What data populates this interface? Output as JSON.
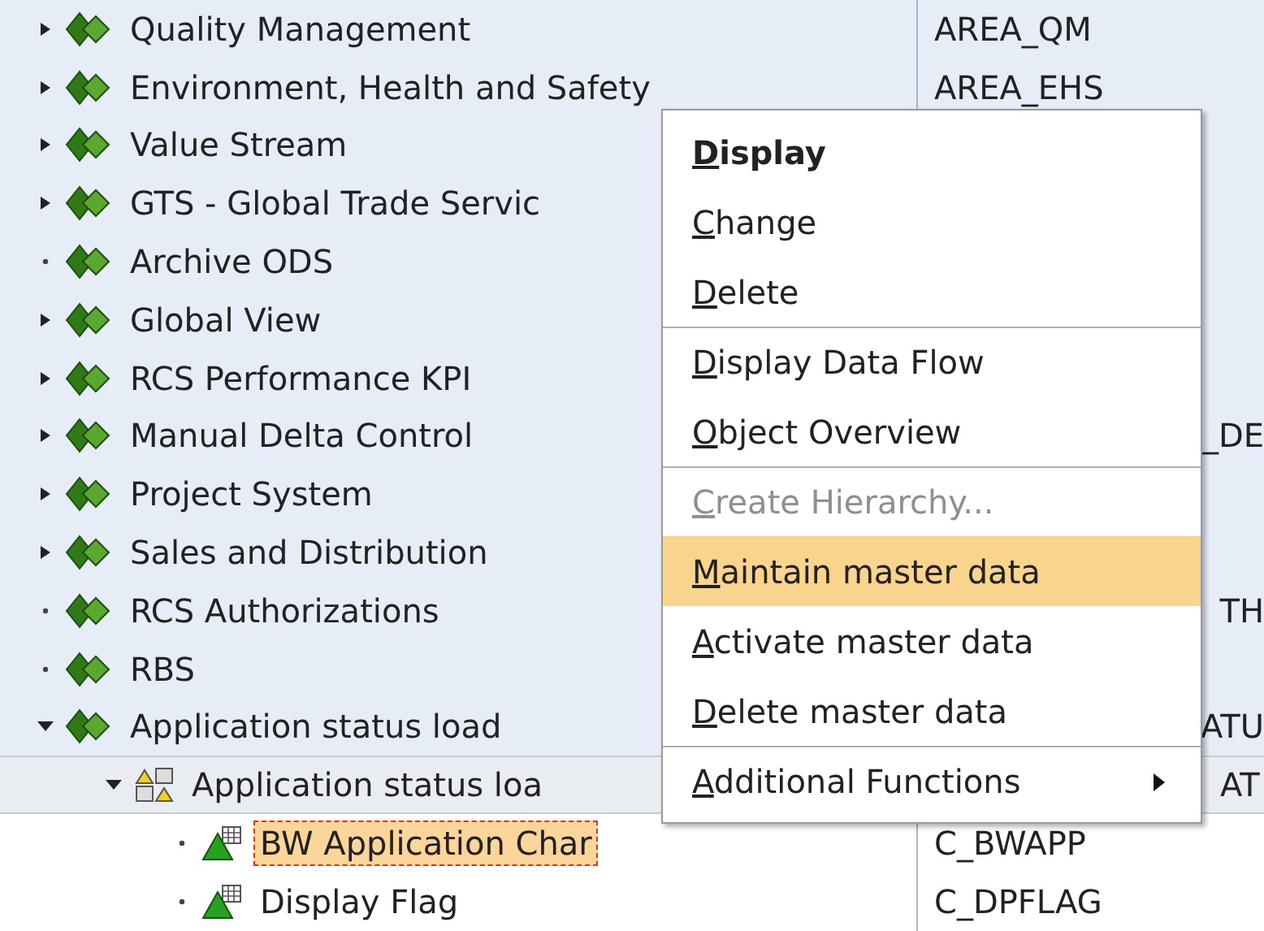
{
  "tree": [
    {
      "label": "Quality Management",
      "kind": "area",
      "expandable": true,
      "expanded": false,
      "selected": false,
      "technical_name": "AREA_QM",
      "name_clipped": false
    },
    {
      "label": "Environment, Health and Safety",
      "kind": "area",
      "expandable": true,
      "expanded": false,
      "selected": false,
      "technical_name": "AREA_EHS",
      "name_clipped": false
    },
    {
      "label": "Value Stream",
      "kind": "area",
      "expandable": true,
      "expanded": false,
      "selected": false
    },
    {
      "label": "GTS - Global Trade Servic",
      "kind": "area",
      "expandable": true,
      "expanded": false,
      "selected": false
    },
    {
      "label": "Archive ODS",
      "kind": "area",
      "expandable": false,
      "selected": false
    },
    {
      "label": "Global View",
      "kind": "area",
      "expandable": true,
      "expanded": false,
      "selected": false
    },
    {
      "label": "RCS Performance KPI",
      "kind": "area",
      "expandable": true,
      "expanded": false,
      "selected": false
    },
    {
      "label": "Manual Delta Control",
      "kind": "area",
      "expandable": true,
      "expanded": false,
      "selected": false,
      "technical_name": "_DE",
      "name_clipped": true
    },
    {
      "label": "Project System",
      "kind": "area",
      "expandable": true,
      "expanded": false,
      "selected": false
    },
    {
      "label": "Sales and Distribution",
      "kind": "area",
      "expandable": true,
      "expanded": false,
      "selected": false
    },
    {
      "label": "RCS Authorizations",
      "kind": "area",
      "expandable": false,
      "selected": false,
      "technical_name": "TH",
      "name_clipped": true
    },
    {
      "label": "RBS",
      "kind": "area",
      "expandable": false,
      "selected": false
    },
    {
      "label": "Application status load",
      "kind": "area",
      "expandable": true,
      "expanded": true,
      "selected": false,
      "technical_name": "ATU",
      "name_clipped": true,
      "children": [
        {
          "label": "Application status loa",
          "kind": "catalog",
          "expandable": true,
          "expanded": true,
          "selected": false,
          "technical_name": "AT",
          "name_clipped": true,
          "children": [
            {
              "label": "BW Application Char",
              "kind": "characteristic",
              "expandable": false,
              "selected": true,
              "technical_name": "C_BWAPP",
              "name_clipped": false
            },
            {
              "label": "Display Flag",
              "kind": "characteristic",
              "expandable": false,
              "selected": false,
              "technical_name": "C_DPFLAG",
              "name_clipped": false
            }
          ]
        }
      ]
    }
  ],
  "context_menu": [
    {
      "label": "Display",
      "default": true,
      "disabled": false,
      "selected": false,
      "separator_before": false,
      "submenu": false
    },
    {
      "label": "Change",
      "default": false,
      "disabled": false,
      "selected": false,
      "separator_before": false,
      "submenu": false
    },
    {
      "label": "Delete",
      "default": false,
      "disabled": false,
      "selected": false,
      "separator_before": false,
      "submenu": false
    },
    {
      "label": "Display Data Flow",
      "default": false,
      "disabled": false,
      "selected": false,
      "separator_before": true,
      "submenu": false
    },
    {
      "label": "Object Overview",
      "default": false,
      "disabled": false,
      "selected": false,
      "separator_before": false,
      "submenu": false
    },
    {
      "label": "Create Hierarchy...",
      "default": false,
      "disabled": true,
      "selected": false,
      "separator_before": true,
      "submenu": false
    },
    {
      "label": "Maintain master data",
      "default": false,
      "disabled": false,
      "selected": true,
      "separator_before": false,
      "submenu": false
    },
    {
      "label": "Activate master data",
      "default": false,
      "disabled": false,
      "selected": false,
      "separator_before": false,
      "submenu": false
    },
    {
      "label": "Delete master data",
      "default": false,
      "disabled": false,
      "selected": false,
      "separator_before": false,
      "submenu": false
    },
    {
      "label": "Additional Functions",
      "default": false,
      "disabled": false,
      "selected": false,
      "separator_before": true,
      "submenu": true
    }
  ]
}
